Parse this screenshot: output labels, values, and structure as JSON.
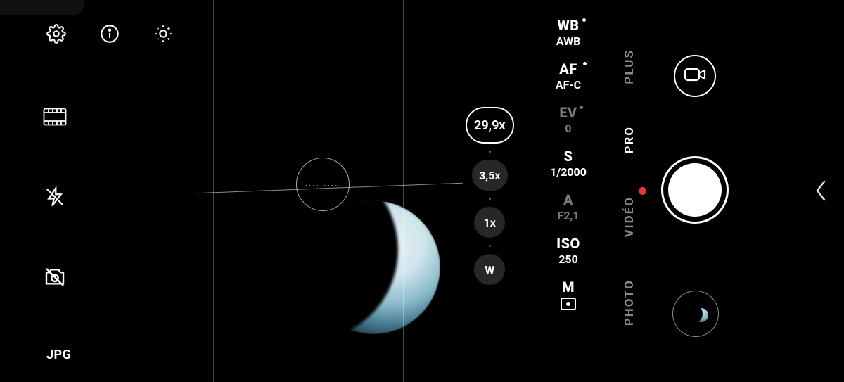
{
  "viewfinder": {
    "subject": "crescent-moon"
  },
  "toolbar": {
    "format_label": "JPG"
  },
  "zoom": {
    "levels": [
      "29,9x",
      "3,5x",
      "1x",
      "W"
    ],
    "active_index": 0
  },
  "pro_settings": {
    "wb": {
      "label": "WB",
      "value": "AWB",
      "indicator": true
    },
    "af": {
      "label": "AF",
      "value": "AF-C",
      "indicator": true
    },
    "ev": {
      "label": "EV",
      "value": "0",
      "indicator": true
    },
    "s": {
      "label": "S",
      "value": "1/2000"
    },
    "a": {
      "label": "A",
      "value": "F2,1"
    },
    "iso": {
      "label": "ISO",
      "value": "250"
    },
    "m": {
      "label": "M"
    }
  },
  "modes": {
    "items": [
      "PLUS",
      "PRO",
      "VIDÉO",
      "PHOTO"
    ],
    "active_index": 1
  },
  "colors": {
    "record_dot": "#e53935"
  }
}
